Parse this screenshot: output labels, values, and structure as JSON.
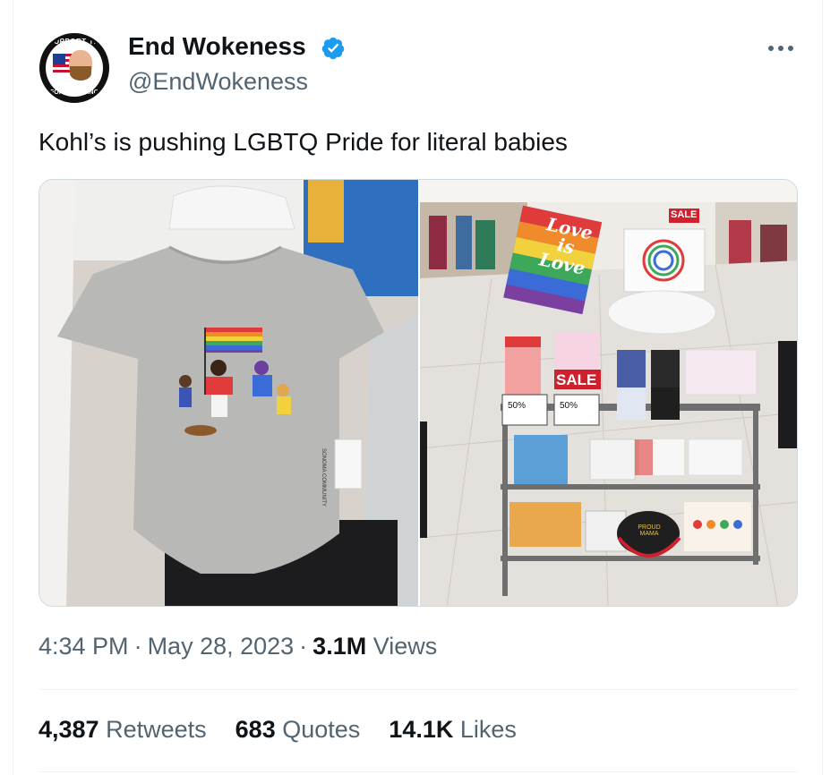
{
  "author": {
    "name": "End Wokeness",
    "handle": "@EndWokeness",
    "verified": true,
    "avatar_text_top": "I SUPPORT THE",
    "avatar_text_bottom": "FORMER THING"
  },
  "tweet": {
    "text": "Kohl’s is pushing LGBTQ Pride for literal babies"
  },
  "media": {
    "left_image": {
      "icon": "photo-onesie",
      "tag_text": "SONOMA COMMUNITY"
    },
    "right_image": {
      "icon": "photo-display",
      "flag_text_1": "Love",
      "flag_text_2": "is",
      "flag_text_3": "Love",
      "sale_sign_top": "SALE",
      "sale_sign_main": "SALE",
      "price_tag_1": "50%",
      "price_tag_2": "50%",
      "hat_text": "PROUD MAMA"
    }
  },
  "meta": {
    "time": "4:34 PM",
    "separator": "·",
    "date": "May 28, 2023",
    "views_count": "3.1M",
    "views_label": "Views"
  },
  "stats": {
    "retweets_count": "4,387",
    "retweets_label": "Retweets",
    "quotes_count": "683",
    "quotes_label": "Quotes",
    "likes_count": "14.1K",
    "likes_label": "Likes"
  },
  "colors": {
    "text_primary": "#0f1419",
    "text_secondary": "#536471",
    "verified_blue": "#1d9bf0",
    "divider": "#eff3f4",
    "sale_red": "#d0202e"
  },
  "icons": {
    "verified": "verified-badge-icon",
    "more": "more-icon"
  }
}
